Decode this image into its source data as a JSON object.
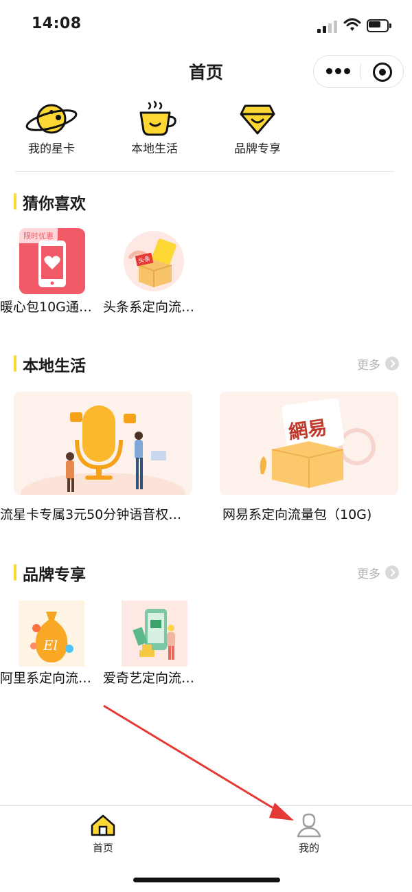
{
  "status_bar": {
    "time": "14:08"
  },
  "header": {
    "title": "首页"
  },
  "quick_links": [
    {
      "label": "我的星卡",
      "icon": "planet-icon"
    },
    {
      "label": "本地生活",
      "icon": "coffee-cup-icon"
    },
    {
      "label": "品牌专享",
      "icon": "diamond-icon"
    }
  ],
  "sections": {
    "guess": {
      "title": "猜你喜欢",
      "items": [
        {
          "label": "暖心包10G通…",
          "badge": "限时优惠"
        },
        {
          "label": "头条系定向流…",
          "badge": "头条"
        }
      ]
    },
    "local": {
      "title": "本地生活",
      "more": "更多",
      "items": [
        {
          "label": "流星卡专属3元50分钟语音权…"
        },
        {
          "label": "网易系定向流量包（10G)",
          "logo_text": "網易"
        }
      ]
    },
    "brand": {
      "title": "品牌专享",
      "more": "更多",
      "items": [
        {
          "label": "阿里系定向流…"
        },
        {
          "label": "爱奇艺定向流…"
        }
      ]
    }
  },
  "tabbar": {
    "home": "首页",
    "mine": "我的"
  },
  "colors": {
    "accent": "#fdd835",
    "arrow": "#e53935"
  }
}
